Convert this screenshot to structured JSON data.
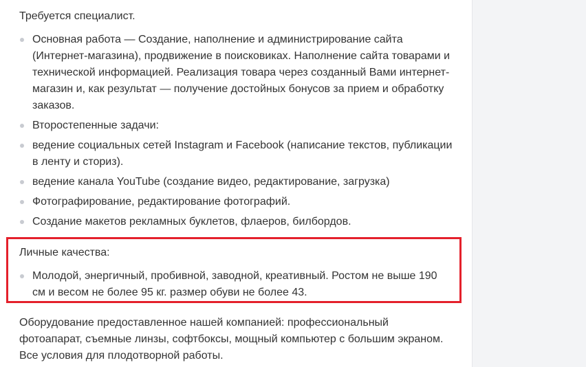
{
  "post": {
    "intro": "Требуется специалист.",
    "duties": [
      "Основная работа — Создание, наполнение и администрирование сайта (Интернет-магазина), продвижение в поисковиках. Наполнение сайта товарами и технической информацией. Реализация товара через созданный Вами интернет-магазин и, как результат — получение достойных бонусов за прием и обработку заказов.",
      "Второстепенные задачи:",
      "ведение социальных сетей Instagram и Facebook (написание текстов, публикации в ленту и сториз).",
      "ведение канала YouTube (создание видео, редактирование, загрузка)",
      "Фотографирование, редактирование фотографий.",
      "Создание макетов рекламных буклетов, флаеров, билбордов."
    ],
    "qualities_title": "Личные качества:",
    "qualities": [
      "Молодой, энергичный, пробивной, заводной, креативный. Ростом не выше 190 см и весом не более 95 кг. размер обуви не более 43."
    ],
    "equipment": "Оборудование предоставленное нашей компанией: профессиональный фотоапарат, съемные линзы, софтбоксы, мощный компьютер с большим экраном. Все условия для плодотворной работы."
  },
  "colors": {
    "text": "#333333",
    "bullet": "#c8cbd1",
    "highlight_border": "#e4202b",
    "side_panel": "#f3f4f6"
  }
}
